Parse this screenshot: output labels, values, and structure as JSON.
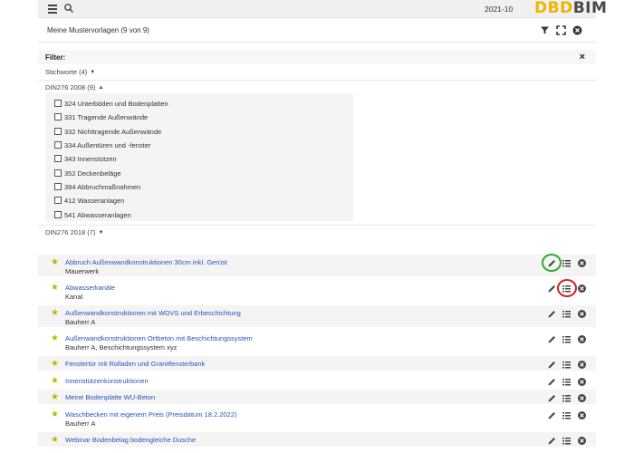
{
  "topbar": {
    "date": "2021-10",
    "logo_a": "DBD",
    "logo_b": "BIM"
  },
  "header": {
    "title": "Meine Mustervorlagen (9 von 9)"
  },
  "filter": {
    "label": "Filter:",
    "close": "×",
    "group1": "Stichworte (4)",
    "group2": "DIN276 2008 (9)",
    "group3": "DIN276 2018 (7)",
    "items": [
      "324 Unterböden und Bodenplatten",
      "331 Tragende Außenwände",
      "332 Nichttragende Außenwände",
      "334 Außentüren und -fenster",
      "343 Innenstützen",
      "352 Deckenbeläge",
      "394 Abbruchmaßnahmen",
      "412 Wasseranlagen",
      "541 Abwasseranlagen"
    ]
  },
  "templates": [
    {
      "name": "Abbruch Außenwandkonstruktionen 30cm inkl. Gerüst",
      "sub": "Mauerwerk"
    },
    {
      "name": "Abwasserkanäle",
      "sub": "Kanal"
    },
    {
      "name": "Außenwandkonstruktionen mit WDVS und Erbeschichtung",
      "sub": "Bauherr A"
    },
    {
      "name": "Außenwandkonstruktionen Ortbeton mit Beschichtungssystem",
      "sub": "Bauherr A, Beschichtungssystem xyz"
    },
    {
      "name": "Fenstertür mit Rolladen und Granitfensterbank",
      "sub": ""
    },
    {
      "name": "Innenstützenkonstruktionen",
      "sub": ""
    },
    {
      "name": "Meine Bodenplatte WU-Beton",
      "sub": ""
    },
    {
      "name": "Waschbecken mit eigenem Preis (Preisdatum 18.2.2022)",
      "sub": "Bauherr A"
    },
    {
      "name": "Webinar Bodenbelag bodengleiche Dusche",
      "sub": ""
    }
  ],
  "colors": {
    "accent": "#f0b400",
    "link": "#2a54b8",
    "star": "#b8b800",
    "highlight_green": "#2faa2f",
    "highlight_red": "#d61f1f"
  }
}
